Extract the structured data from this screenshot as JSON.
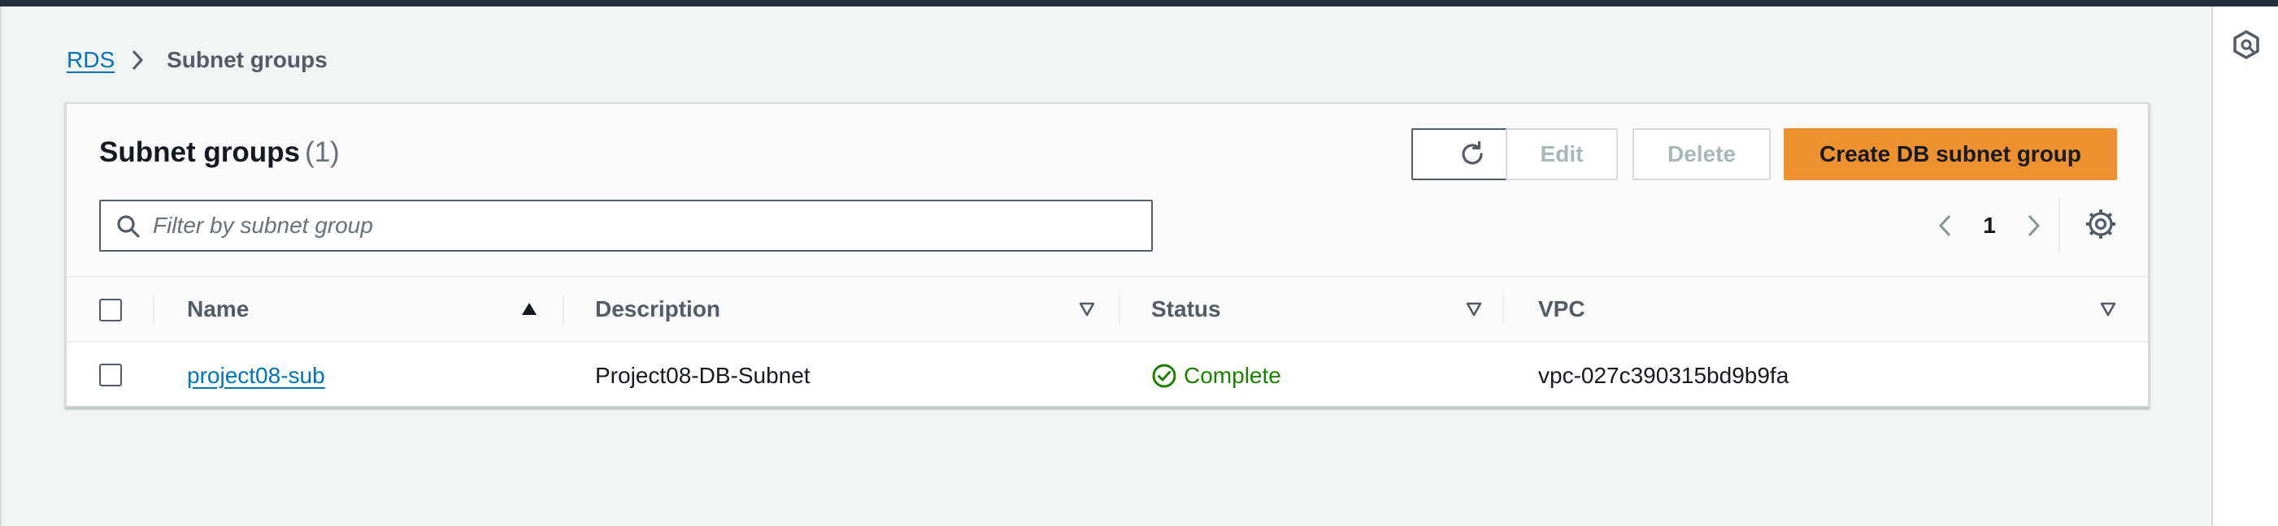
{
  "breadcrumb": {
    "root": "RDS",
    "current": "Subnet groups"
  },
  "panel": {
    "title": "Subnet groups",
    "count": "(1)"
  },
  "actions": {
    "edit": "Edit",
    "delete": "Delete",
    "create": "Create DB subnet group"
  },
  "filter": {
    "placeholder": "Filter by subnet group",
    "value": ""
  },
  "pagination": {
    "current_page": "1"
  },
  "table": {
    "columns": [
      "Name",
      "Description",
      "Status",
      "VPC"
    ],
    "rows": [
      {
        "name": "project08-sub",
        "description": "Project08-DB-Subnet",
        "status": "Complete",
        "vpc": "vpc-027c390315bd9b9fa"
      }
    ]
  },
  "colors": {
    "link": "#0073bb",
    "primary_button": "#ec912d",
    "status_success": "#1d8102",
    "top_bar": "#232f3e"
  },
  "icons": [
    "refresh-icon",
    "search-icon",
    "chevron-left-icon",
    "chevron-right-icon",
    "settings-gear-icon",
    "sort-ascending-icon",
    "sort-descending-icon",
    "status-success-icon",
    "breadcrumb-chevron-icon",
    "help-panel-icon"
  ]
}
